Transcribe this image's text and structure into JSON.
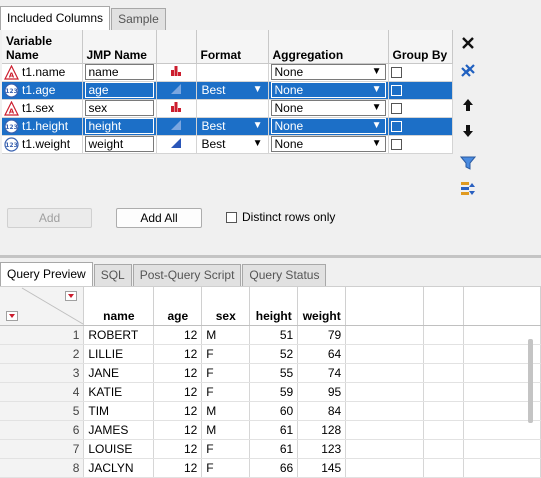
{
  "top_tabs": [
    "Included Columns",
    "Sample"
  ],
  "columns_table": {
    "headers": {
      "variable_name": "Variable Name",
      "jmp_name": "JMP Name",
      "format": "Format",
      "aggregation": "Aggregation",
      "group_by": "Group By"
    },
    "rows": [
      {
        "name": "t1.name",
        "jmp": "name",
        "type": "character",
        "format": "",
        "aggregation": "None",
        "selected": false
      },
      {
        "name": "t1.age",
        "jmp": "age",
        "type": "numeric",
        "format": "Best",
        "aggregation": "None",
        "selected": true
      },
      {
        "name": "t1.sex",
        "jmp": "sex",
        "type": "character",
        "format": "",
        "aggregation": "None",
        "selected": false
      },
      {
        "name": "t1.height",
        "jmp": "height",
        "type": "numeric",
        "format": "Best",
        "aggregation": "None",
        "selected": true
      },
      {
        "name": "t1.weight",
        "jmp": "weight",
        "type": "numeric",
        "format": "Best",
        "aggregation": "None",
        "selected": false
      }
    ]
  },
  "side_buttons": [
    "close-icon",
    "remove-all-icon",
    "move-up-icon",
    "move-down-icon",
    "filter-icon",
    "sort-icon"
  ],
  "buttons": {
    "add": "Add",
    "add_all": "Add All"
  },
  "distinct_label": "Distinct rows only",
  "bottom_tabs": [
    "Query Preview",
    "SQL",
    "Post-Query Script",
    "Query Status"
  ],
  "preview": {
    "headers": [
      "name",
      "age",
      "sex",
      "height",
      "weight"
    ],
    "rows": [
      [
        "1",
        "ROBERT",
        "12",
        "M",
        "51",
        "79"
      ],
      [
        "2",
        "LILLIE",
        "12",
        "F",
        "52",
        "64"
      ],
      [
        "3",
        "JANE",
        "12",
        "F",
        "55",
        "74"
      ],
      [
        "4",
        "KATIE",
        "12",
        "F",
        "59",
        "95"
      ],
      [
        "5",
        "TIM",
        "12",
        "M",
        "60",
        "84"
      ],
      [
        "6",
        "JAMES",
        "12",
        "M",
        "61",
        "128"
      ],
      [
        "7",
        "LOUISE",
        "12",
        "F",
        "61",
        "123"
      ],
      [
        "8",
        "JACLYN",
        "12",
        "F",
        "66",
        "145"
      ]
    ]
  },
  "colors": {
    "selection": "#1c6fc7",
    "accent_red": "#cc1d2e",
    "numeric_icon": "#3a62b0"
  }
}
